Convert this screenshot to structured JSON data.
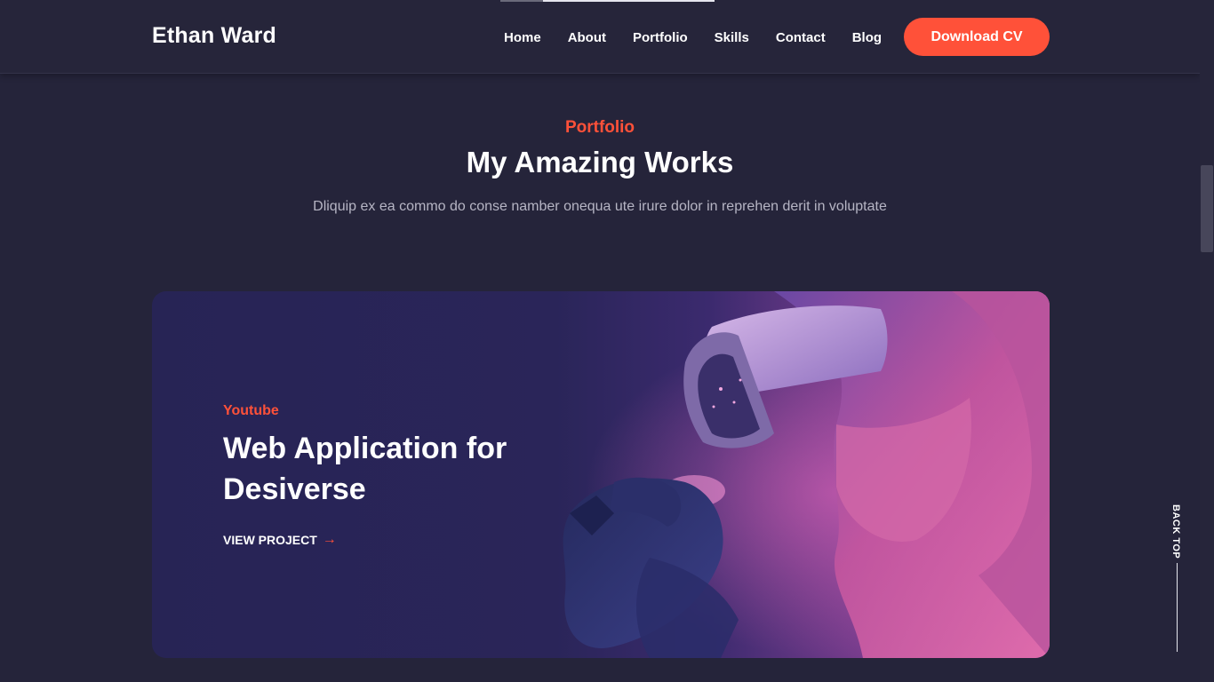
{
  "header": {
    "logo": "Ethan Ward",
    "nav": [
      "Home",
      "About",
      "Portfolio",
      "Skills",
      "Contact",
      "Blog"
    ],
    "cta": "Download CV"
  },
  "section": {
    "label": "Portfolio",
    "title": "My Amazing Works",
    "description": "Dliquip ex ea commo do conse namber onequa ute irure dolor in reprehen derit in voluptate"
  },
  "project": {
    "tag": "Youtube",
    "title": "Web Application for Desiverse",
    "link": "VIEW PROJECT",
    "link_icon": "arrow-right-icon"
  },
  "back_top": {
    "label": "BACK TOP"
  },
  "colors": {
    "accent": "#ff5139",
    "background": "#25243a",
    "text": "#ffffff",
    "muted": "#b6b5c4"
  }
}
